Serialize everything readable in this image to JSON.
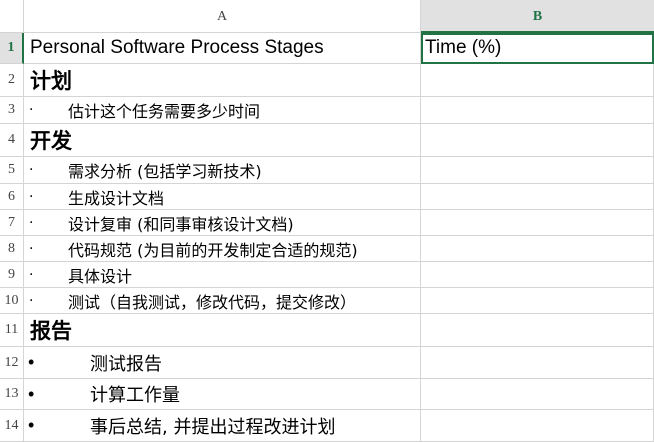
{
  "columns": {
    "a": "A",
    "b": "B"
  },
  "rows": [
    {
      "num": "1",
      "a": "Personal Software Process Stages",
      "b": "Time (%)"
    },
    {
      "num": "2",
      "a": "计划"
    },
    {
      "num": "3",
      "bullet": "·",
      "a": "估计这个任务需要多少时间"
    },
    {
      "num": "4",
      "a": "开发"
    },
    {
      "num": "5",
      "bullet": "·",
      "a": "需求分析 (包括学习新技术)"
    },
    {
      "num": "6",
      "bullet": "·",
      "a": "生成设计文档"
    },
    {
      "num": "7",
      "bullet": "·",
      "a": "设计复审 (和同事审核设计文档)"
    },
    {
      "num": "8",
      "bullet": "·",
      "a": "代码规范 (为目前的开发制定合适的规范)"
    },
    {
      "num": "9",
      "bullet": "·",
      "a": "具体设计"
    },
    {
      "num": "10",
      "bullet": "·",
      "a": "测试（自我测试，修改代码，提交修改）"
    },
    {
      "num": "11",
      "a": "报告"
    },
    {
      "num": "12",
      "bullet": "•",
      "a": "测试报告"
    },
    {
      "num": "13",
      "bullet": "•",
      "a": "计算工作量"
    },
    {
      "num": "14",
      "bullet": "•",
      "a": "事后总结, 并提出过程改进计划"
    }
  ],
  "colors": {
    "accent": "#217346",
    "grid": "#d4d4d4",
    "header_bg": "#e1e1e1"
  }
}
